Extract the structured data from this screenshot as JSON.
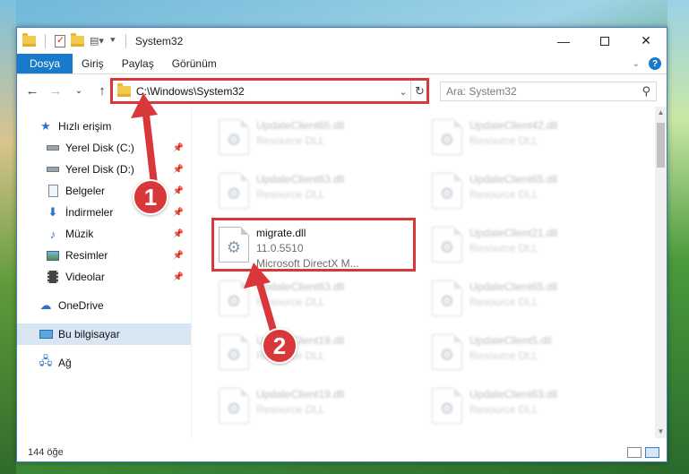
{
  "window": {
    "title": "System32"
  },
  "ribbon": {
    "tabs": [
      "Dosya",
      "Giriş",
      "Paylaş",
      "Görünüm"
    ]
  },
  "address": {
    "path": "C:\\Windows\\System32"
  },
  "search": {
    "placeholder": "Ara: System32"
  },
  "sidebar": {
    "items": [
      {
        "label": "Hızlı erişim",
        "icon": "star-icon"
      },
      {
        "label": "Yerel Disk (C:)",
        "icon": "drive-icon",
        "pinned": true
      },
      {
        "label": "Yerel Disk (D:)",
        "icon": "drive-icon",
        "pinned": true
      },
      {
        "label": "Belgeler",
        "icon": "documents-icon",
        "pinned": true
      },
      {
        "label": "İndirmeler",
        "icon": "download-icon",
        "pinned": true
      },
      {
        "label": "Müzik",
        "icon": "music-icon",
        "pinned": true
      },
      {
        "label": "Resimler",
        "icon": "pictures-icon",
        "pinned": true
      },
      {
        "label": "Videolar",
        "icon": "videos-icon",
        "pinned": true
      },
      {
        "label": "OneDrive",
        "icon": "cloud-icon"
      },
      {
        "label": "Bu bilgisayar",
        "icon": "computer-icon",
        "active": true
      },
      {
        "label": "Ağ",
        "icon": "network-icon"
      }
    ]
  },
  "files": [
    {
      "name": "UpdateClient65.dll",
      "sub": "Resource DLL",
      "blurred": true
    },
    {
      "name": "UpdateClient42.dll",
      "sub": "Resource DLL",
      "blurred": true
    },
    {
      "name": "UpdateClient63.dll",
      "sub": "Resource DLL",
      "blurred": true
    },
    {
      "name": "UpdateClient65.dll",
      "sub": "Resource DLL",
      "blurred": true
    },
    {
      "name": "migrate.dll",
      "version": "11.0.5510",
      "sub": "Microsoft DirectX M...",
      "blurred": false
    },
    {
      "name": "UpdateClient21.dll",
      "sub": "Resource DLL",
      "blurred": true
    },
    {
      "name": "UpdateClient63.dll",
      "sub": "Resource DLL",
      "blurred": true
    },
    {
      "name": "UpdateClient65.dll",
      "sub": "Resource DLL",
      "blurred": true
    },
    {
      "name": "UpdateClient19.dll",
      "sub": "Resource DLL",
      "blurred": true
    },
    {
      "name": "UpdateClient5.dll",
      "sub": "Resource DLL",
      "blurred": true
    },
    {
      "name": "UpdateClient19.dll",
      "sub": "Resource DLL",
      "blurred": true
    },
    {
      "name": "UpdateClient63.dll",
      "sub": "Resource DLL",
      "blurred": true
    }
  ],
  "status": {
    "count": "144 öğe"
  },
  "annotations": {
    "step1": "1",
    "step2": "2",
    "color": "#d9383a"
  }
}
